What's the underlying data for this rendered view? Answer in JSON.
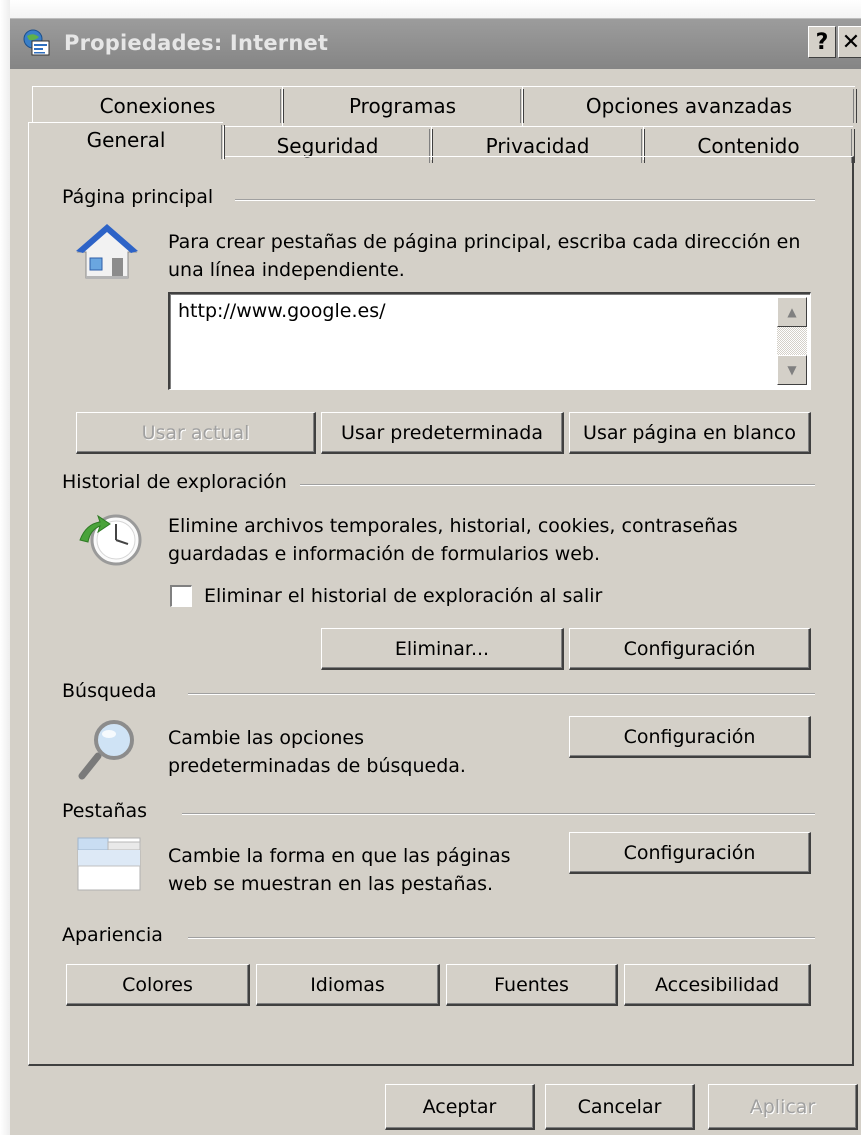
{
  "window": {
    "title": "Propiedades: Internet",
    "help_label": "?",
    "close_label": "✕"
  },
  "tabs": {
    "back_row": [
      "Conexiones",
      "Programas",
      "Opciones avanzadas"
    ],
    "front_row": [
      "General",
      "Seguridad",
      "Privacidad",
      "Contenido"
    ],
    "active": "General"
  },
  "home_page": {
    "group_title": "Página principal",
    "description_line1": "Para crear pestañas de página principal, escriba cada dirección en",
    "description_line2": "una línea independiente.",
    "url_value": "http://www.google.es/",
    "buttons": {
      "use_current": "Usar actual",
      "use_default": "Usar predeterminada",
      "use_blank": "Usar página en blanco"
    }
  },
  "history": {
    "group_title": "Historial de exploración",
    "description_line1": "Elimine archivos temporales, historial, cookies, contraseñas",
    "description_line2": "guardadas e información de formularios web.",
    "checkbox_label": "Eliminar el historial de exploración al salir",
    "checkbox_checked": false,
    "buttons": {
      "delete": "Eliminar...",
      "settings": "Configuración"
    }
  },
  "search": {
    "group_title": "Búsqueda",
    "description_line1": "Cambie las opciones",
    "description_line2": "predeterminadas de búsqueda.",
    "settings_button": "Configuración"
  },
  "tabs_section": {
    "group_title": "Pestañas",
    "description_line1": "Cambie la forma en que las páginas",
    "description_line2": "web se muestran en las pestañas.",
    "settings_button": "Configuración"
  },
  "appearance": {
    "group_title": "Apariencia",
    "buttons": {
      "colors": "Colores",
      "languages": "Idiomas",
      "fonts": "Fuentes",
      "accessibility": "Accesibilidad"
    }
  },
  "footer": {
    "ok": "Aceptar",
    "cancel": "Cancelar",
    "apply": "Aplicar"
  }
}
